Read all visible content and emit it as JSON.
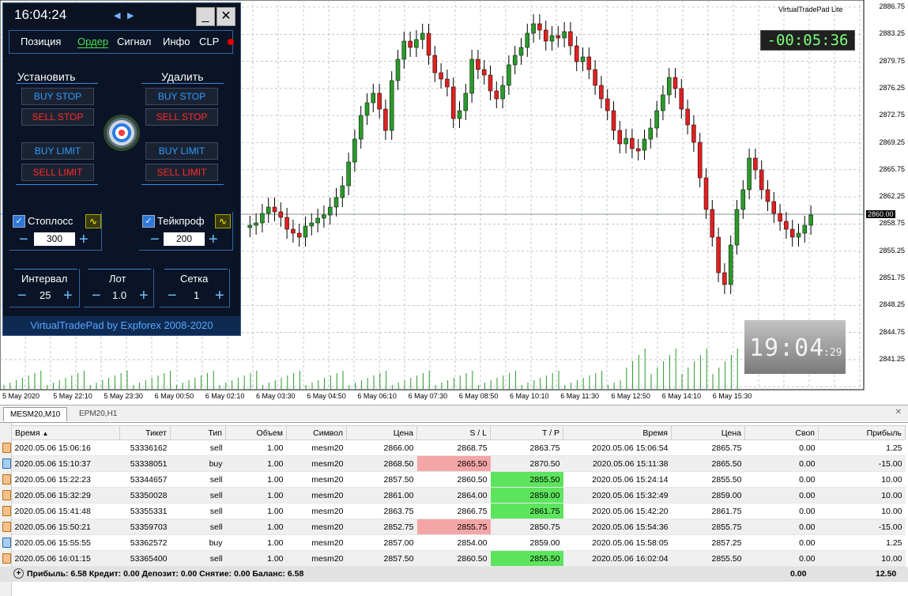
{
  "chart": {
    "vtp_title": "VirtualTradePad  Lite",
    "timer": "-00:05:36",
    "big_clock_main": "19:04",
    "big_clock_sec": ":29",
    "current_price": "2860.00",
    "price_labels": [
      "2886.75",
      "2883.25",
      "2879.75",
      "2876.25",
      "2872.75",
      "2869.25",
      "2865.75",
      "2862.25",
      "2858.75",
      "2855.25",
      "2851.75",
      "2848.25",
      "2844.75",
      "2841.25"
    ],
    "time_labels": [
      "5 May 2020",
      "5 May 22:10",
      "5 May 23:30",
      "6 May 00:50",
      "6 May 02:10",
      "6 May 03:30",
      "6 May 04:50",
      "6 May 06:10",
      "6 May 07:30",
      "6 May 08:50",
      "6 May 10:10",
      "6 May 11:30",
      "6 May 12:50",
      "6 May 14:10",
      "6 May 15:30"
    ]
  },
  "panel": {
    "clock": "16:04:24",
    "min_btn": "_",
    "close_btn": "✕",
    "tabs": [
      "Позиция",
      "Ордер",
      "Сигнал",
      "Инфо",
      "CLP"
    ],
    "set_title": "Установить",
    "delete_title": "Удалить",
    "buttons": {
      "buy_stop": "BUY STOP",
      "sell_stop": "SELL STOP",
      "buy_limit": "BUY LIMIT",
      "sell_limit": "SELL LIMIT"
    },
    "stoploss_label": "Стоплосс",
    "stoploss_value": "300",
    "takeprofit_label": "Тейкпроф",
    "takeprofit_value": "200",
    "interval_label": "Интервал",
    "interval_value": "25",
    "lot_label": "Лот",
    "lot_value": "1.0",
    "grid_label": "Сетка",
    "grid_value": "1",
    "footer": "VirtualTradePad by Expforex 2008-2020"
  },
  "tabbar": {
    "tabs": [
      "MESM20,M10",
      "EPM20,H1"
    ],
    "close": "✕"
  },
  "terminal": {
    "columns": [
      "Время",
      "Тикет",
      "Тип",
      "Объем",
      "Символ",
      "Цена",
      "S / L",
      "T / P",
      "Время",
      "Цена",
      "Своп",
      "Прибыль"
    ],
    "rows": [
      [
        "2020.05.06 15:06:16",
        "53336162",
        "sell",
        "1.00",
        "mesm20",
        "2866.00",
        "2868.75",
        "2863.75",
        "2020.05.06 15:06:54",
        "2865.75",
        "0.00",
        "1.25"
      ],
      [
        "2020.05.06 15:10:37",
        "53338051",
        "buy",
        "1.00",
        "mesm20",
        "2868.50",
        "2865.50",
        "2870.50",
        "2020.05.06 15:11:38",
        "2865.50",
        "0.00",
        "-15.00"
      ],
      [
        "2020.05.06 15:22:23",
        "53344657",
        "sell",
        "1.00",
        "mesm20",
        "2857.50",
        "2860.50",
        "2855.50",
        "2020.05.06 15:24:14",
        "2855.50",
        "0.00",
        "10.00"
      ],
      [
        "2020.05.06 15:32:29",
        "53350028",
        "sell",
        "1.00",
        "mesm20",
        "2861.00",
        "2864.00",
        "2859.00",
        "2020.05.06 15:32:49",
        "2859.00",
        "0.00",
        "10.00"
      ],
      [
        "2020.05.06 15:41:48",
        "53355331",
        "sell",
        "1.00",
        "mesm20",
        "2863.75",
        "2866.75",
        "2861.75",
        "2020.05.06 15:42:20",
        "2861.75",
        "0.00",
        "10.00"
      ],
      [
        "2020.05.06 15:50:21",
        "53359703",
        "sell",
        "1.00",
        "mesm20",
        "2852.75",
        "2855.75",
        "2850.75",
        "2020.05.06 15:54:36",
        "2855.75",
        "0.00",
        "-15.00"
      ],
      [
        "2020.05.06 15:55:55",
        "53362572",
        "buy",
        "1.00",
        "mesm20",
        "2857.00",
        "2854.00",
        "2859.00",
        "2020.05.06 15:58:05",
        "2857.25",
        "0.00",
        "1.25"
      ],
      [
        "2020.05.06 16:01:15",
        "53365400",
        "sell",
        "1.00",
        "mesm20",
        "2857.50",
        "2860.50",
        "2855.50",
        "2020.05.06 16:02:04",
        "2855.50",
        "0.00",
        "10.00"
      ]
    ],
    "highlights": [
      {
        "row": 1,
        "col": 6,
        "color": "red"
      },
      {
        "row": 2,
        "col": 7,
        "color": "green"
      },
      {
        "row": 3,
        "col": 7,
        "color": "green"
      },
      {
        "row": 4,
        "col": 7,
        "color": "green"
      },
      {
        "row": 5,
        "col": 6,
        "color": "red"
      },
      {
        "row": 7,
        "col": 7,
        "color": "green"
      }
    ],
    "summary_text": "Прибыль: 6.58  Кредит: 0.00  Депозит: 0.00  Снятие: 0.00  Баланс: 6.58",
    "summary_swap": "0.00",
    "summary_profit": "12.50"
  },
  "colors": {
    "bull": "#2a9a2a",
    "bear": "#e02020",
    "panel_bg": "#0a1426",
    "accent": "#4be04b"
  }
}
